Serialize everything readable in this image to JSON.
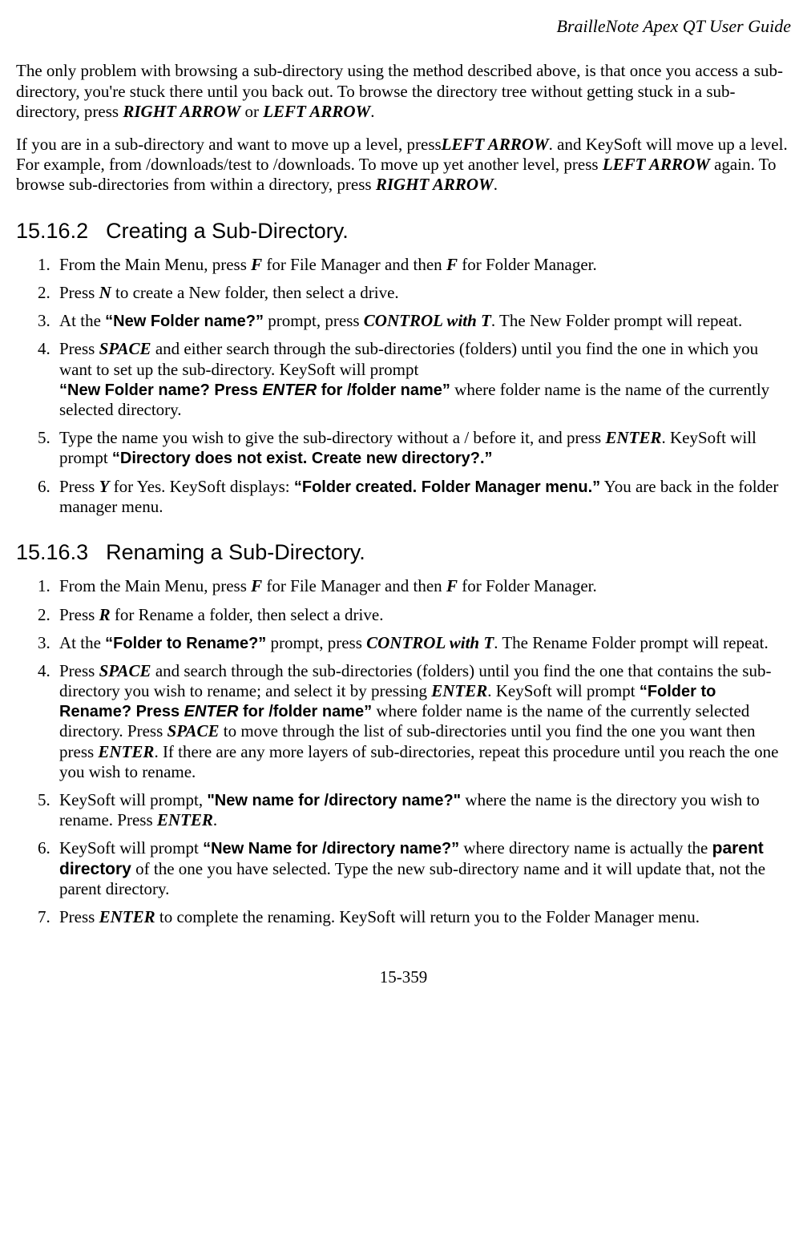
{
  "header": {
    "title": "BrailleNote Apex QT User Guide"
  },
  "para1": {
    "t1": "The only problem with browsing a sub-directory using the method described above, is that once you access a sub-directory, you're stuck there until you back out. To browse the directory tree without getting stuck in a sub-directory, press ",
    "k1": "RIGHT ARROW",
    "t2": " or ",
    "k2": "LEFT ARROW",
    "t3": "."
  },
  "para2": {
    "t1": "If you are in a sub-directory and want to move up a level, press",
    "k1": "LEFT ARROW",
    "t2": ". and KeySoft will move up a level. For example, from /downloads/test to /downloads. To move up yet another level, press ",
    "k2": "LEFT ARROW",
    "t3": " again. To browse sub-directories from within a directory, press ",
    "k3": "RIGHT ARROW",
    "t4": "."
  },
  "sec1": {
    "num": "15.16.2",
    "title": "Creating a Sub-Directory."
  },
  "list1": {
    "i1": {
      "t1": "From the Main Menu, press ",
      "k1": "F",
      "t2": " for File Manager and then ",
      "k2": "F",
      "t3": " for Folder Manager."
    },
    "i2": {
      "t1": "Press ",
      "k1": "N",
      "t2": " to create a New folder, then select a drive."
    },
    "i3": {
      "t1": "At the ",
      "p1": "“New Folder name?”",
      "t2": " prompt, press ",
      "k1": "CONTROL with T",
      "t3": ". The New Folder prompt will repeat."
    },
    "i4": {
      "t1": "Press ",
      "k1": "SPACE",
      "t2": " and either search through the sub-directories (folders) until you find the one in which you want to set up the sub-directory. KeySoft will prompt ",
      "p1a": "“New Folder name? Press ",
      "p1k": "ENTER",
      "p1b": " for /folder name”",
      "t3": " where folder name is the name of the currently selected directory."
    },
    "i5": {
      "t1": "Type the name you wish to give the sub-directory without a / before it, and press ",
      "k1": "ENTER",
      "t2": ". KeySoft will prompt ",
      "p1": "“Directory does not exist. Create new directory?.”"
    },
    "i6": {
      "t1": "Press ",
      "k1": "Y",
      "t2": " for Yes. KeySoft displays: ",
      "p1": "“Folder created. Folder Manager menu.”",
      "t3": " You are back in the folder manager menu."
    }
  },
  "sec2": {
    "num": "15.16.3",
    "title": "Renaming a Sub-Directory."
  },
  "list2": {
    "i1": {
      "t1": "From the Main Menu, press ",
      "k1": "F",
      "t2": " for File Manager and then ",
      "k2": "F",
      "t3": " for Folder Manager."
    },
    "i2": {
      "t1": "Press ",
      "k1": "R",
      "t2": " for Rename a folder, then select a drive."
    },
    "i3": {
      "t1": "At the ",
      "p1": "“Folder to Rename?”",
      "t2": " prompt, press ",
      "k1": "CONTROL with T",
      "t3": ". The Rename Folder prompt will repeat."
    },
    "i4": {
      "t1": "Press ",
      "k1": "SPACE",
      "t2": " and search through the sub-directories (folders) until you find the one that contains the sub-directory you wish to rename; and select it by pressing ",
      "k2": "ENTER",
      "t3": ". KeySoft will prompt ",
      "p1a": "“Folder to Rename? Press ",
      "p1k": "ENTER",
      "p1b": " for /folder name”",
      "t4": " where folder name is the name of the currently selected directory. Press ",
      "k3": "SPACE",
      "t5": " to move through the list of sub-directories until you find the one you want then press ",
      "k4": "ENTER",
      "t6": ". If there are any more layers of sub-directories, repeat this procedure until you reach the one you wish to rename."
    },
    "i5": {
      "t1": "KeySoft will prompt, ",
      "p1": "\"New name for /directory name?\"",
      "t2": " where the name is the directory you wish to rename. Press ",
      "k1": "ENTER",
      "t3": "."
    },
    "i6": {
      "t1": "KeySoft will prompt ",
      "p1": "“New Name for /directory name?”",
      "t2": " where directory name is actually the ",
      "b1": "parent directory",
      "t3": " of the one you have selected. Type the new sub-directory name and it will update that, not the parent directory."
    },
    "i7": {
      "t1": "Press ",
      "k1": "ENTER",
      "t2": " to complete the renaming. KeySoft will return you to the Folder Manager menu."
    }
  },
  "footer": {
    "page": "15-359"
  }
}
